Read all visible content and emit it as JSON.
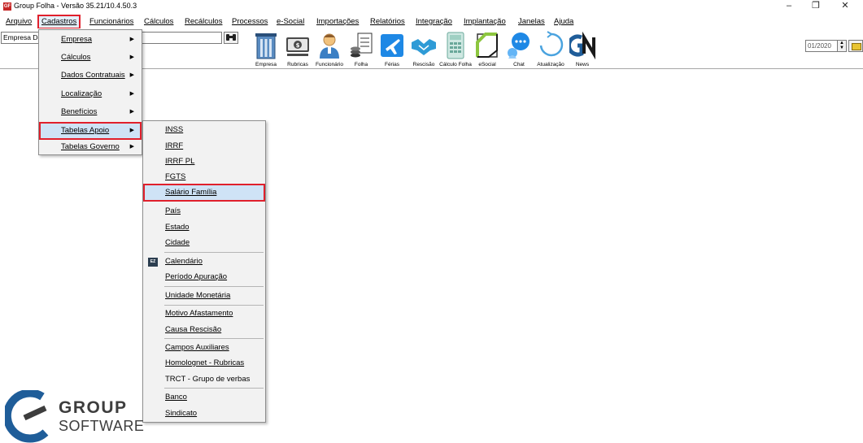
{
  "window": {
    "title": "Group Folha - Versão 35.21/10.4.50.3",
    "minimize": "–",
    "restore": "❐",
    "close": "✕"
  },
  "menubar": {
    "items": [
      {
        "label": "Arquivo"
      },
      {
        "label": "Cadastros",
        "active": true
      },
      {
        "label": "Funcionários"
      },
      {
        "label": "Cálculos"
      },
      {
        "label": "Recálculos"
      },
      {
        "label": "Processos"
      },
      {
        "label": "e-Social"
      },
      {
        "label": "Importações"
      },
      {
        "label": "Relatórios"
      },
      {
        "label": "Integração"
      },
      {
        "label": "Implantação"
      },
      {
        "label": "Janelas"
      },
      {
        "label": "Ajuda"
      }
    ]
  },
  "toolbar": {
    "company_value": "Empresa De",
    "search_icon": "binoculars-icon",
    "buttons": [
      {
        "label": "Empresa",
        "icon": "building-icon"
      },
      {
        "label": "Rubricas",
        "icon": "money-icon"
      },
      {
        "label": "Funcionário",
        "icon": "employee-icon"
      },
      {
        "label": "Folha",
        "icon": "payroll-icon"
      },
      {
        "label": "Férias",
        "icon": "vacation-icon"
      },
      {
        "label": "Rescisão",
        "icon": "handshake-icon"
      },
      {
        "label": "Cálculo Folha",
        "icon": "calculator-icon"
      },
      {
        "label": "eSocial",
        "icon": "esocial-icon"
      },
      {
        "label": "Chat",
        "icon": "chat-icon"
      },
      {
        "label": "Atualização",
        "icon": "refresh-icon"
      },
      {
        "label": "News",
        "icon": "news-icon"
      }
    ],
    "period": "01/2020"
  },
  "cadastros_menu": {
    "items": [
      {
        "label": "Empresa",
        "has_submenu": true
      },
      {
        "label": "Cálculos",
        "has_submenu": true
      },
      {
        "label": "Dados Contratuais",
        "has_submenu": true
      },
      {
        "label": "Localização",
        "has_submenu": true
      },
      {
        "label": "Benefícios",
        "has_submenu": true
      },
      {
        "label": "Tabelas Apoio",
        "has_submenu": true,
        "highlighted": true
      },
      {
        "label": "Tabelas Governo",
        "has_submenu": true
      }
    ]
  },
  "tabelas_apoio_menu": {
    "items": [
      {
        "label": "INSS"
      },
      {
        "label": "IRRF"
      },
      {
        "label": "IRRF PL"
      },
      {
        "label": "FGTS"
      },
      {
        "label": "Salário Família",
        "highlighted": true
      },
      {
        "label": "País"
      },
      {
        "label": "Estado"
      },
      {
        "label": "Cidade"
      },
      {
        "label": "Calendário",
        "icon": "calendar-icon",
        "icon_text": "EZ"
      },
      {
        "label": "Período Apuração"
      },
      {
        "label": "Unidade Monetária"
      },
      {
        "label": "Motivo Afastamento"
      },
      {
        "label": "Causa Rescisão"
      },
      {
        "label": "Campos Auxiliares"
      },
      {
        "label": "Homolognet - Rubricas"
      },
      {
        "label": "TRCT - Grupo de verbas"
      },
      {
        "label": "Banco"
      },
      {
        "label": "Sindicato"
      }
    ]
  },
  "logo": {
    "line1": "GROUP",
    "line2": "SOFTWARE"
  },
  "colors": {
    "highlight_border": "#e0202c",
    "highlight_fill": "#cfe3f6",
    "logo_blue": "#1f5d99",
    "logo_text": "#3d3d3d"
  }
}
